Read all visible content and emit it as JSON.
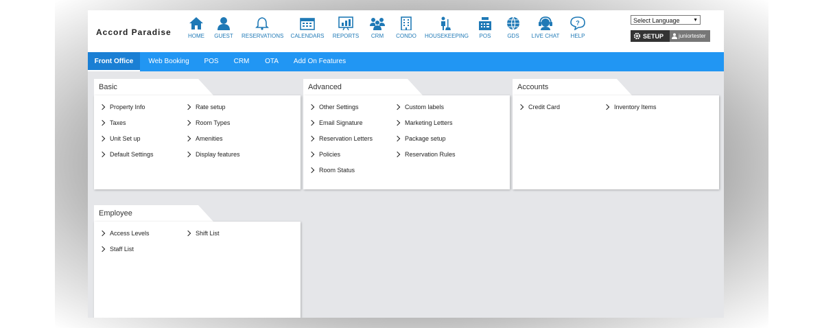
{
  "header": {
    "brand": "Accord Paradise",
    "nav": [
      {
        "label": "HOME",
        "icon": "home-icon"
      },
      {
        "label": "GUEST",
        "icon": "user-icon"
      },
      {
        "label": "RESERVATIONS",
        "icon": "bell-icon"
      },
      {
        "label": "CALENDARS",
        "icon": "calendar-icon"
      },
      {
        "label": "REPORTS",
        "icon": "chart-icon"
      },
      {
        "label": "CRM",
        "icon": "group-icon"
      },
      {
        "label": "CONDO",
        "icon": "building-icon"
      },
      {
        "label": "HOUSEKEEPING",
        "icon": "cleaner-icon"
      },
      {
        "label": "POS",
        "icon": "register-icon"
      },
      {
        "label": "GDS",
        "icon": "globe-icon"
      },
      {
        "label": "LIVE CHAT",
        "icon": "headset-icon"
      },
      {
        "label": "HELP",
        "icon": "help-bubble-icon"
      }
    ],
    "language_select": "Select Language",
    "setup_label": "SETUP",
    "username": "juniortester",
    "accent": "#1f79b6"
  },
  "tabs": [
    {
      "label": "Front Office",
      "active": true
    },
    {
      "label": "Web Booking"
    },
    {
      "label": "POS"
    },
    {
      "label": "CRM"
    },
    {
      "label": "OTA"
    },
    {
      "label": "Add On Features"
    }
  ],
  "tabbar_color": "#2196f3",
  "panels": {
    "basic": {
      "title": "Basic",
      "items": [
        "Property Info",
        "Rate setup",
        "Taxes",
        "Room Types",
        "Unit Set up",
        "Amenities",
        "Default Settings",
        "Display features"
      ]
    },
    "advanced": {
      "title": "Advanced",
      "items": [
        "Other Settings",
        "Custom labels",
        "Email Signature",
        "Marketing Letters",
        "Reservation Letters",
        "Package setup",
        "Policies",
        "Reservation Rules",
        "Room Status"
      ]
    },
    "accounts": {
      "title": "Accounts",
      "items": [
        "Credit Card",
        "Inventory Items"
      ]
    },
    "employee": {
      "title": "Employee",
      "items": [
        "Access Levels",
        "Shift List",
        "Staff List"
      ]
    }
  }
}
